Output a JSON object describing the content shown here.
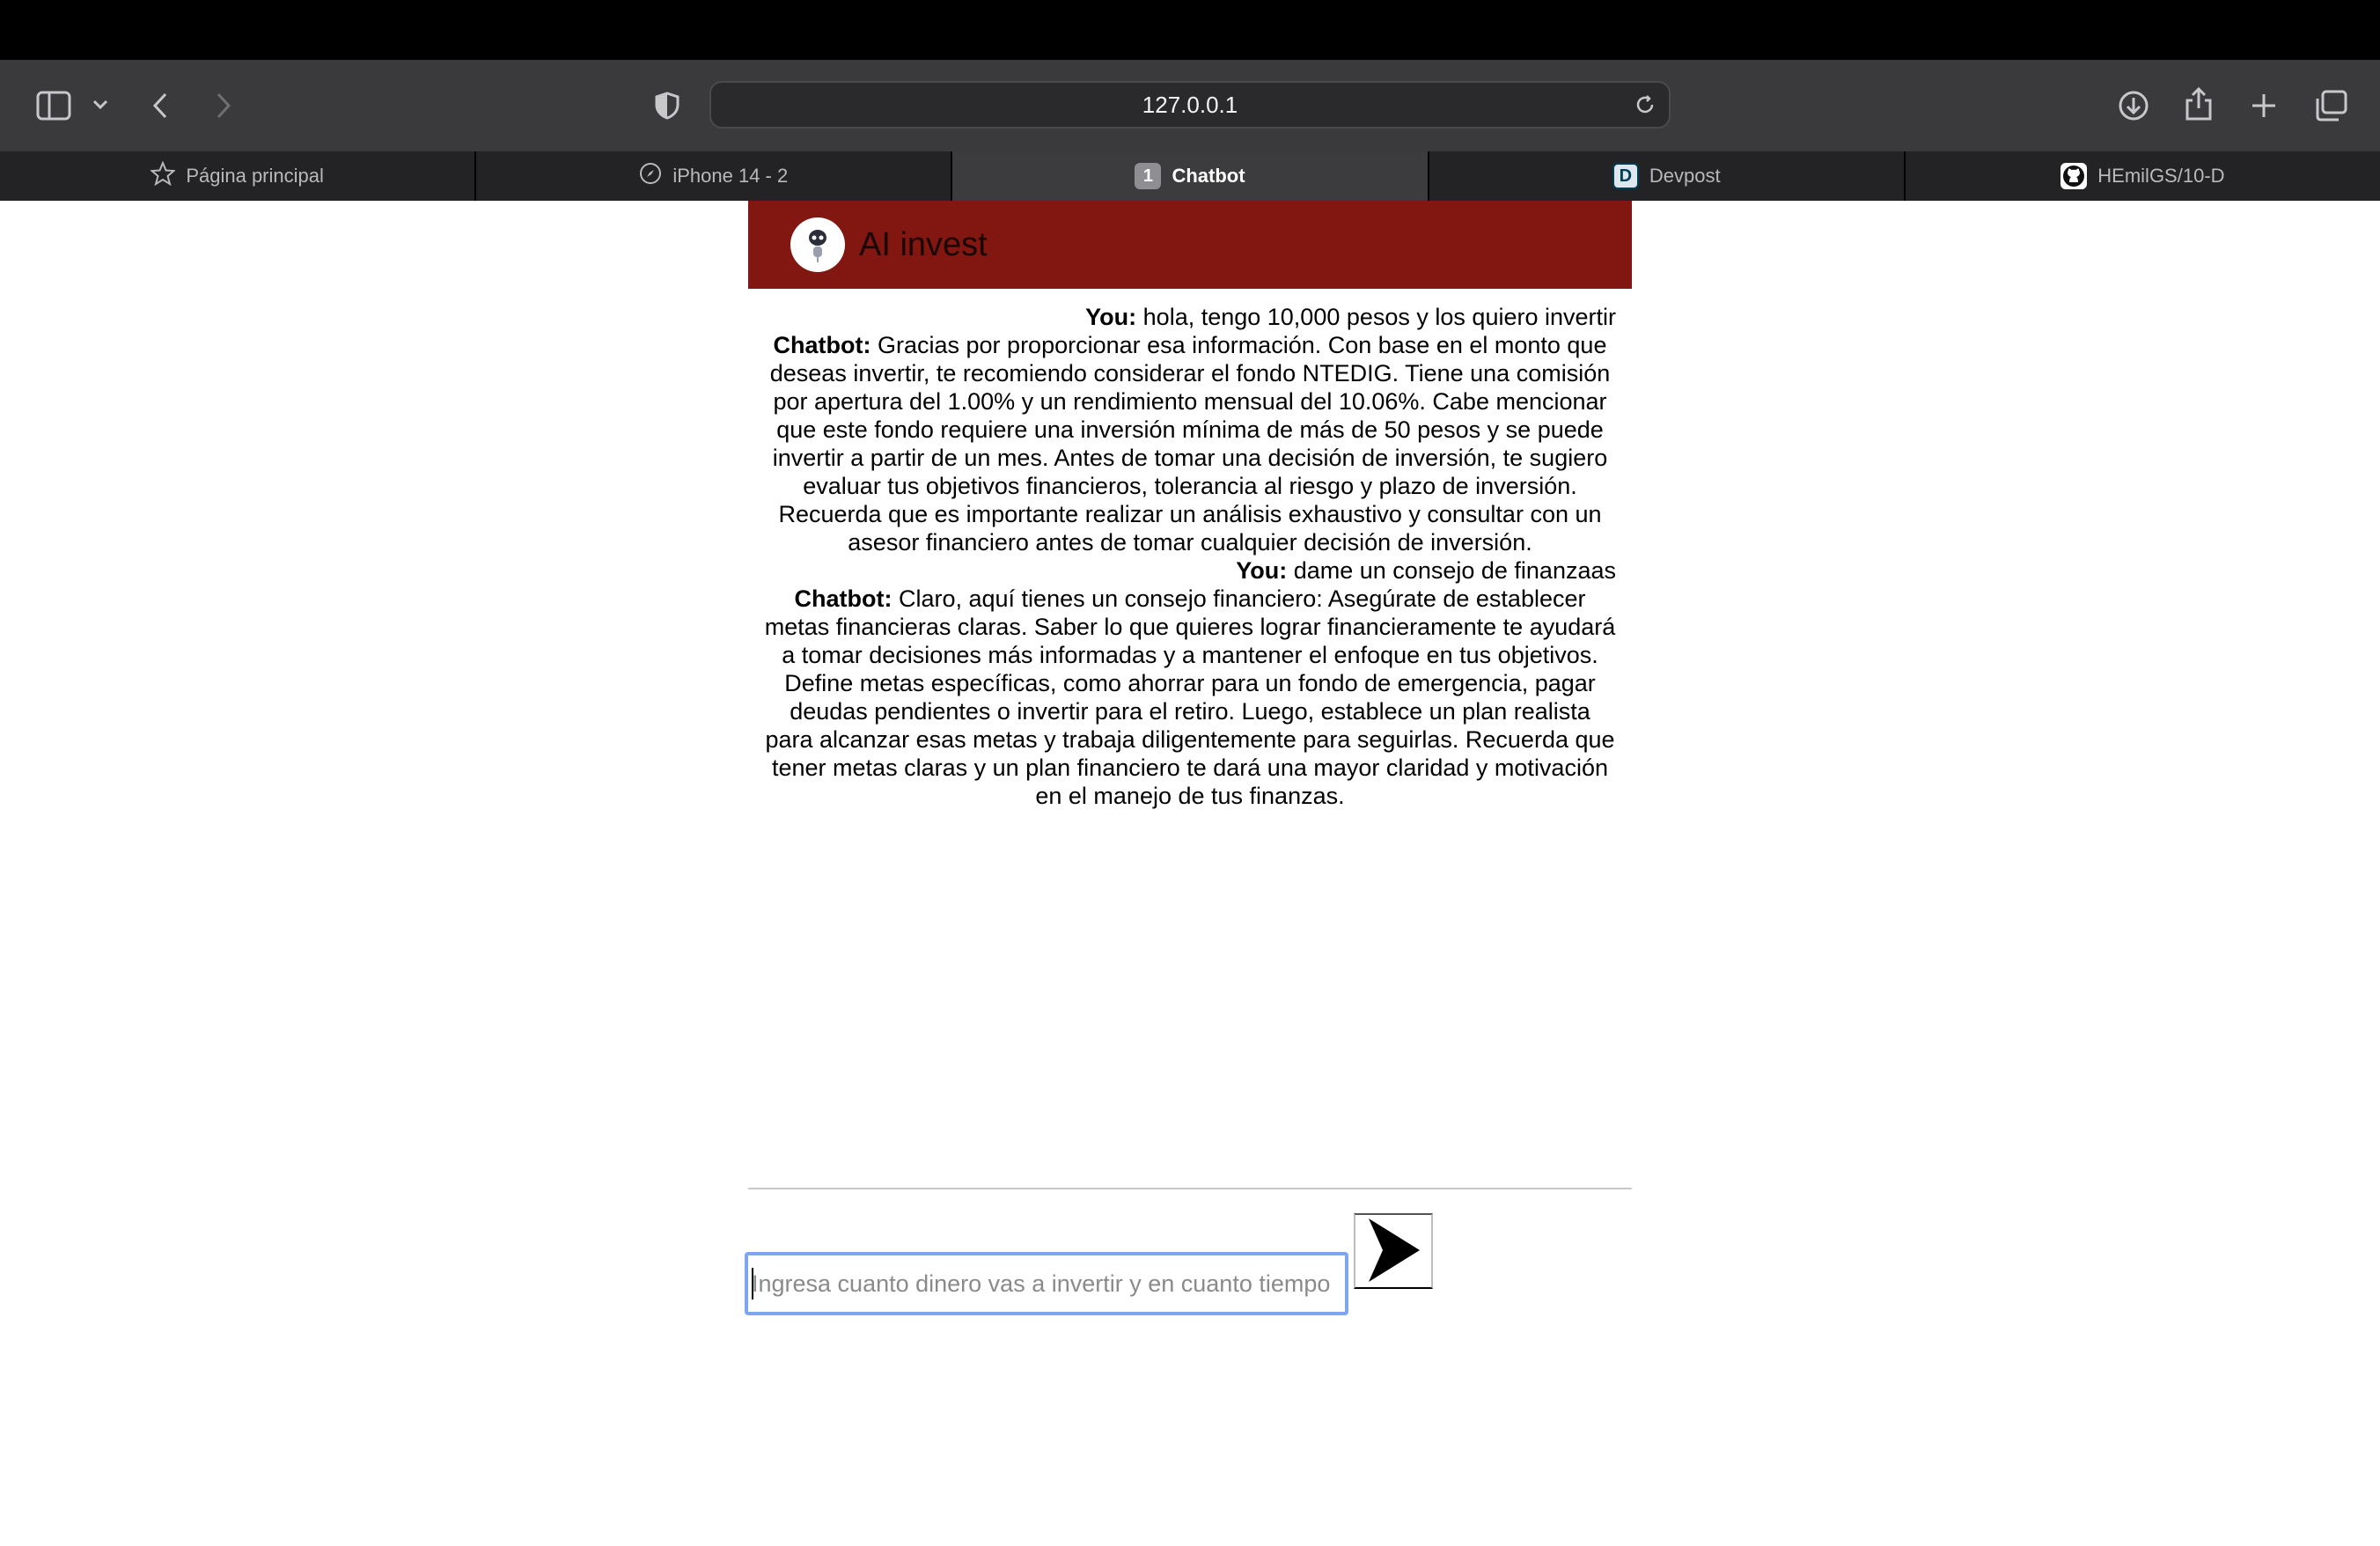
{
  "browser": {
    "url": "127.0.0.1",
    "tabs": [
      {
        "label": "Página principal",
        "icon": "star-icon"
      },
      {
        "label": "iPhone 14 - 2",
        "icon": "compass-icon"
      },
      {
        "label": "Chatbot",
        "badge": "1",
        "active": true
      },
      {
        "label": "Devpost",
        "badge": "D"
      },
      {
        "label": "HEmilGS/10-D",
        "icon": "github-icon"
      }
    ]
  },
  "app": {
    "title": "AI invest",
    "accent_color": "#821711"
  },
  "messages": [
    {
      "speaker": "You:",
      "text": " hola, tengo 10,000 pesos y los quiero invertir"
    },
    {
      "speaker": "Chatbot:",
      "text": " Gracias por proporcionar esa información. Con base en el monto que deseas invertir, te recomiendo considerar el fondo NTEDIG. Tiene una comisión por apertura del 1.00% y un rendimiento mensual del 10.06%. Cabe mencionar que este fondo requiere una inversión mínima de más de 50 pesos y se puede invertir a partir de un mes. Antes de tomar una decisión de inversión, te sugiero evaluar tus objetivos financieros, tolerancia al riesgo y plazo de inversión. Recuerda que es importante realizar un análisis exhaustivo y consultar con un asesor financiero antes de tomar cualquier decisión de inversión."
    },
    {
      "speaker": "You:",
      "text": " dame un consejo de finanzaas"
    },
    {
      "speaker": "Chatbot:",
      "text": " Claro, aquí tienes un consejo financiero: Asegúrate de establecer metas financieras claras. Saber lo que quieres lograr financieramente te ayudará a tomar decisiones más informadas y a mantener el enfoque en tus objetivos. Define metas específicas, como ahorrar para un fondo de emergencia, pagar deudas pendientes o invertir para el retiro. Luego, establece un plan realista para alcanzar esas metas y trabaja diligentemente para seguirlas. Recuerda que tener metas claras y un plan financiero te dará una mayor claridad y motivación en el manejo de tus finanzas."
    }
  ],
  "composer": {
    "placeholder": "Ingresa cuanto dinero vas a invertir y en cuanto tiempo",
    "send_icon": "send-arrow-icon"
  }
}
